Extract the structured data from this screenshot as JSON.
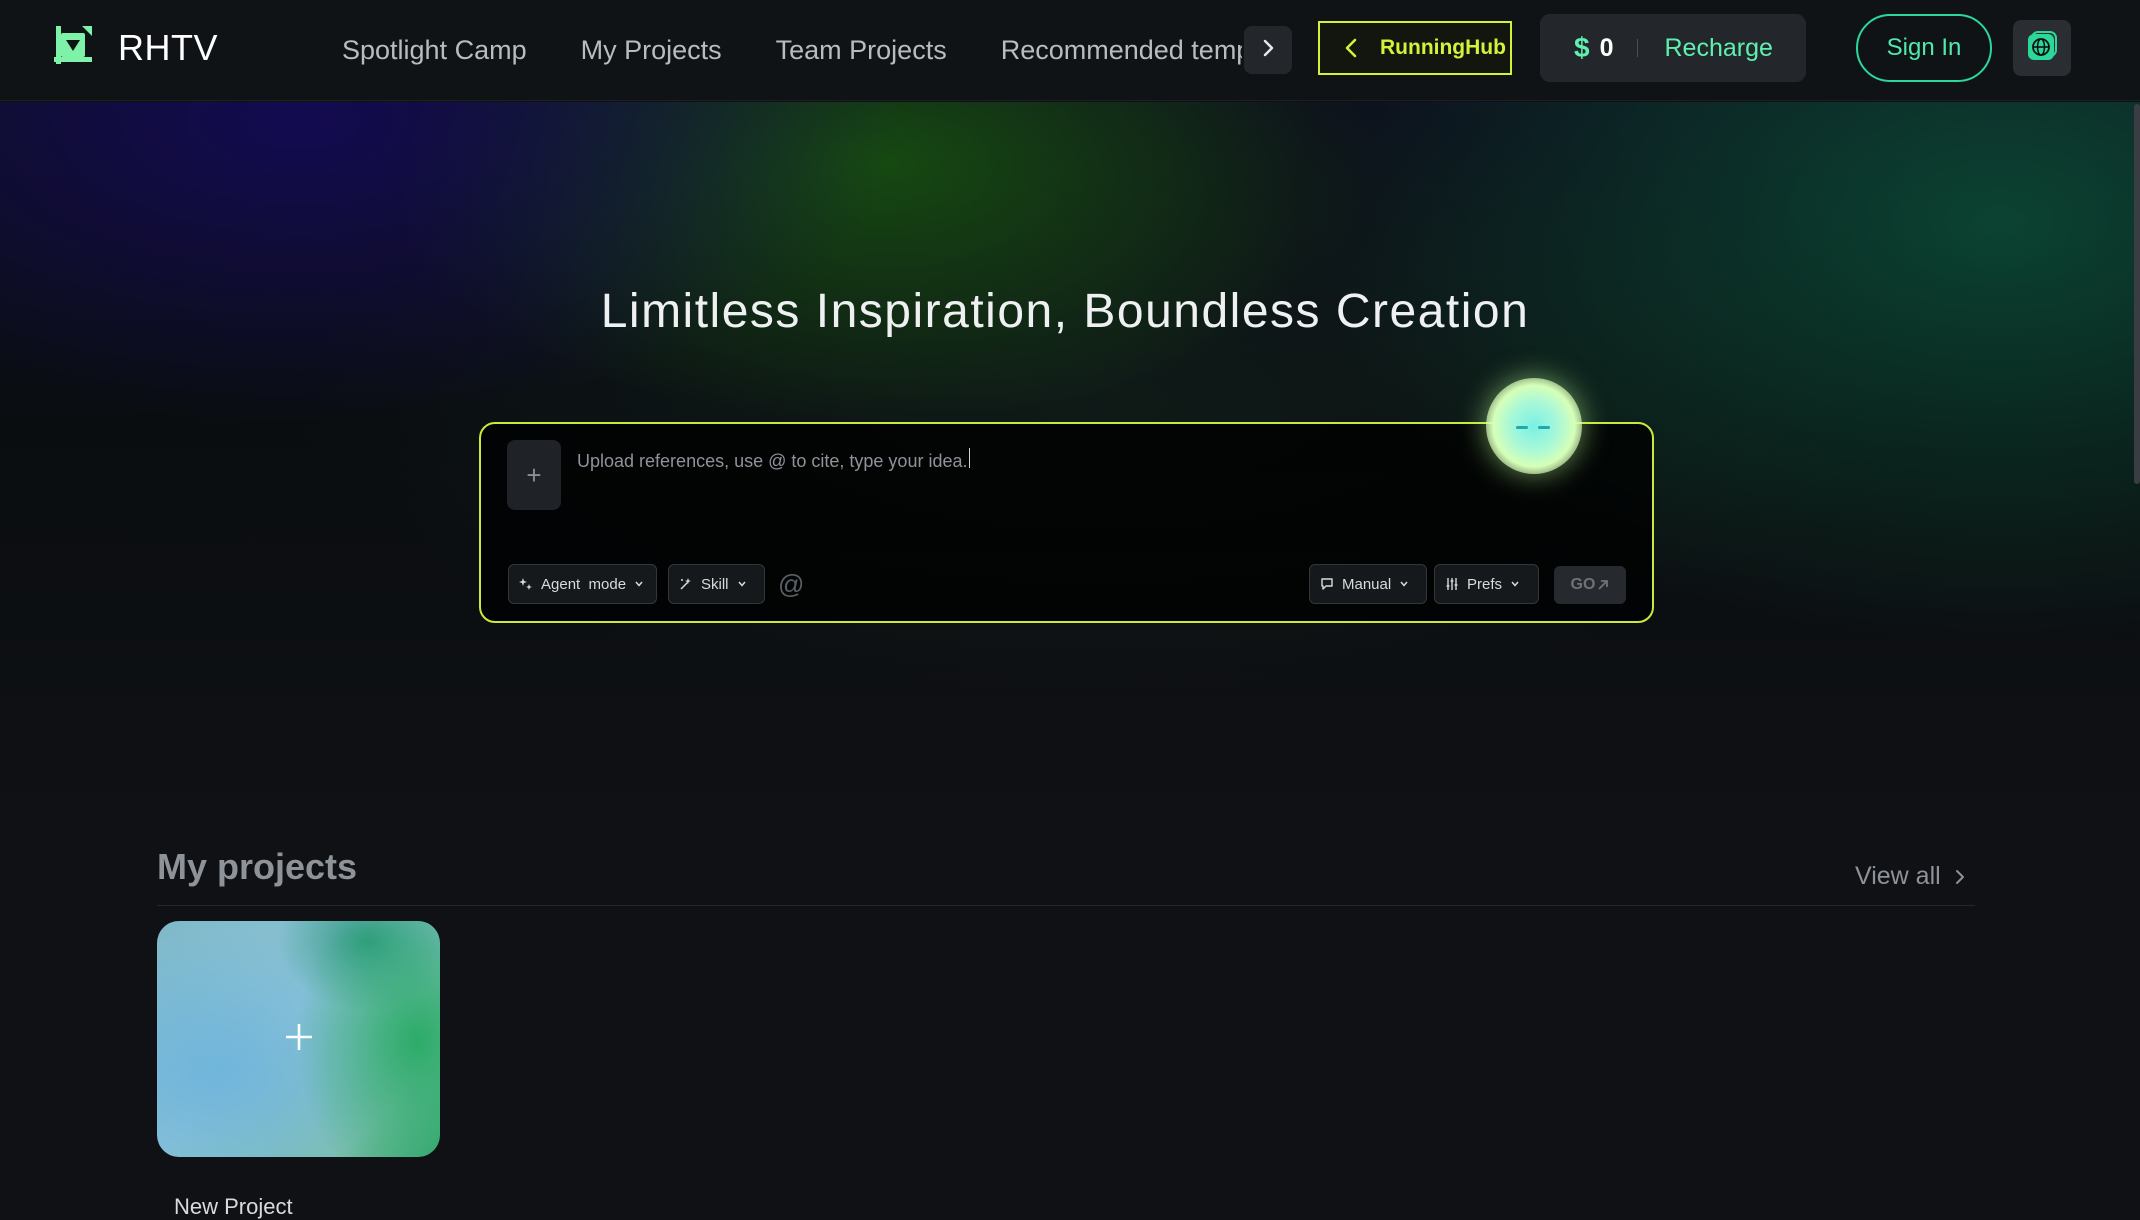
{
  "brand": {
    "name": "RHTV"
  },
  "nav": {
    "items": [
      "Spotlight Camp",
      "My Projects",
      "Team Projects",
      "Recommended templates"
    ]
  },
  "header": {
    "runninghub_label": "RunningHub",
    "wallet": {
      "currency_symbol": "$",
      "balance": "0",
      "recharge_label": "Recharge"
    },
    "signin_label": "Sign In"
  },
  "hero": {
    "title": "Limitless Inspiration, Boundless Creation",
    "prompt": {
      "upload_symbol": "+",
      "placeholder": "Upload references, use @ to cite, type your idea.",
      "agent_mode_label": "Agent  mode",
      "skill_label": "Skill",
      "mention_symbol": "@",
      "manual_label": "Manual",
      "prefs_label": "Prefs",
      "go_label": "GO"
    }
  },
  "projects": {
    "title": "My projects",
    "view_all_label": "View all",
    "new_project_label": "New Project"
  },
  "colors": {
    "accent_lime": "#d4f23a",
    "accent_green": "#5ff0b0",
    "signin_border": "#2bd89a",
    "background": "#0f1114"
  },
  "icons": [
    "logo-icon",
    "chevron-right-icon",
    "chevron-left-icon",
    "globe-icon",
    "sparkle-icon",
    "skill-icon",
    "chevron-down-icon",
    "chat-icon",
    "sliders-icon",
    "arrow-up-right-icon",
    "plus-icon"
  ]
}
